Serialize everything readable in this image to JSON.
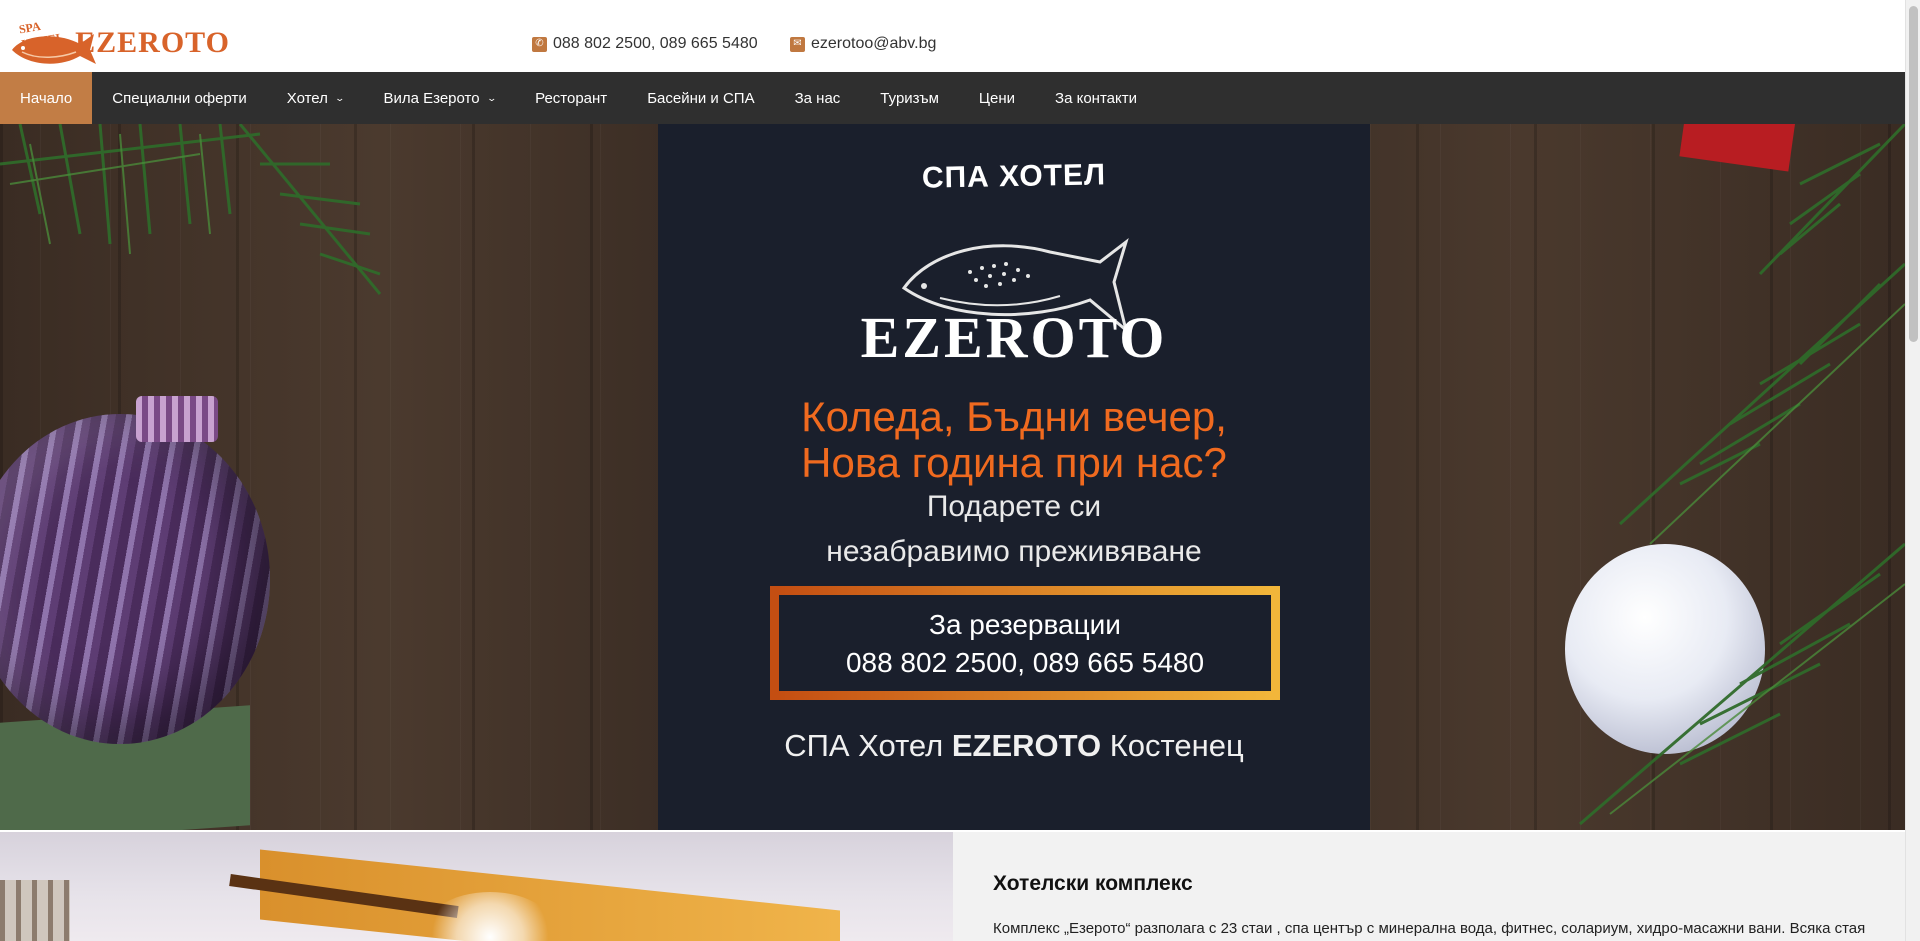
{
  "logo": {
    "small_text": "SPA HOTEL",
    "word": "EZEROTO"
  },
  "contacts": {
    "phone": "088 802 2500, 089 665 5480",
    "email": "ezerotoo@abv.bg"
  },
  "nav": {
    "items": [
      {
        "label": "Начало",
        "active": true,
        "dropdown": false
      },
      {
        "label": "Специални оферти",
        "active": false,
        "dropdown": false
      },
      {
        "label": "Хотел",
        "active": false,
        "dropdown": true
      },
      {
        "label": "Вила Езерото",
        "active": false,
        "dropdown": true
      },
      {
        "label": "Ресторант",
        "active": false,
        "dropdown": false
      },
      {
        "label": "Басейни и СПА",
        "active": false,
        "dropdown": false
      },
      {
        "label": "За нас",
        "active": false,
        "dropdown": false
      },
      {
        "label": "Туризъм",
        "active": false,
        "dropdown": false
      },
      {
        "label": "Цени",
        "active": false,
        "dropdown": false
      },
      {
        "label": "За контакти",
        "active": false,
        "dropdown": false
      }
    ]
  },
  "hero": {
    "spa_hotel": "СПА ХОТЕЛ",
    "brand": "EZEROTO",
    "headline_1": "Коледа, Бъдни вечер,",
    "headline_2": "Нова година при нас?",
    "sub_1": "Подарете си",
    "sub_2": "незабравимо преживяване",
    "box_1": "За резервации",
    "box_2": "088 802 2500, 089 665 5480",
    "footer_pre": "СПА Хотел",
    "footer_brand": "EZEROTO",
    "footer_post": "Костенец"
  },
  "complex": {
    "title": "Хотелски комплекс",
    "text": "Комплекс „Езерото“ разполага с 23 стаи , спа център с минерална вода, фитнес, солариум, хидро-масажни вани. Всяка стая"
  },
  "colors": {
    "accent": "#c27d45",
    "nav_bg": "#2f2f2f",
    "logo": "#d8632a",
    "poster_orange": "#f06a1f",
    "poster_bg": "#1a1f2c"
  },
  "icons": {
    "phone": "phone-icon",
    "email": "envelope-icon"
  }
}
